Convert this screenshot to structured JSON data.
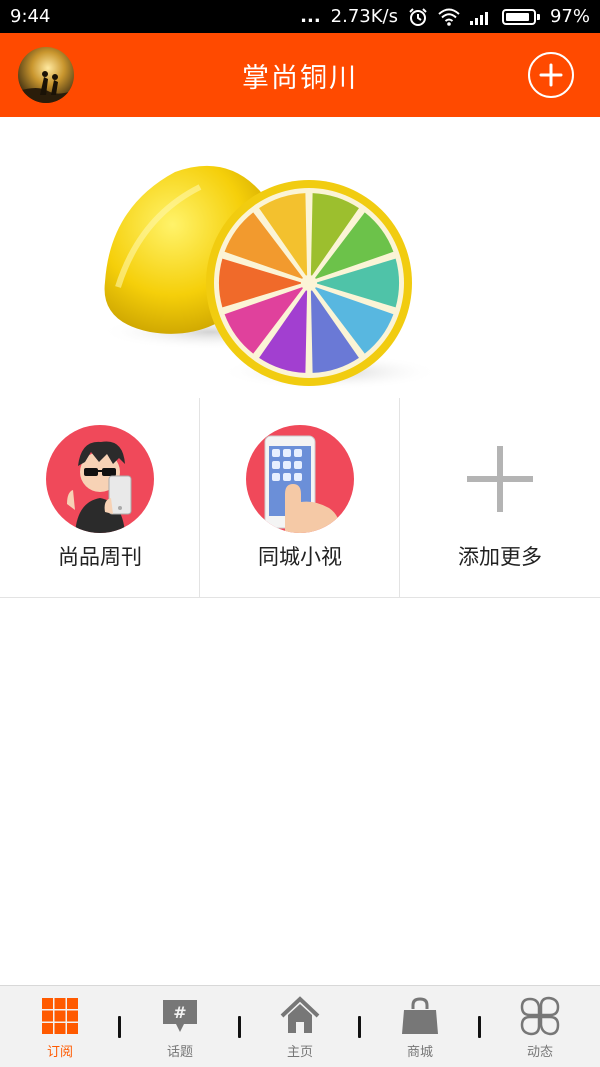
{
  "status_bar": {
    "time": "9:44",
    "dots": "...",
    "speed": "2.73K/s",
    "battery": "97%",
    "icons": [
      "alarm-icon",
      "wifi-icon",
      "signal-icon",
      "battery-icon"
    ]
  },
  "app_bar": {
    "title": "掌尚铜川",
    "accent": "#ff4a00"
  },
  "grid": {
    "items": [
      {
        "label": "尚品周刊",
        "icon": "weekly-avatar-icon"
      },
      {
        "label": "同城小视",
        "icon": "phone-video-icon"
      },
      {
        "label": "添加更多",
        "icon": "plus-icon"
      }
    ]
  },
  "bottom_nav": {
    "active_color": "#ff5a00",
    "items": [
      {
        "label": "订阅",
        "icon": "grid-icon",
        "active": true
      },
      {
        "label": "话题",
        "icon": "hashtag-bubble-icon",
        "active": false
      },
      {
        "label": "主页",
        "icon": "home-icon",
        "active": false
      },
      {
        "label": "商城",
        "icon": "shopping-bag-icon",
        "active": false
      },
      {
        "label": "动态",
        "icon": "clover-icon",
        "active": false
      }
    ]
  }
}
